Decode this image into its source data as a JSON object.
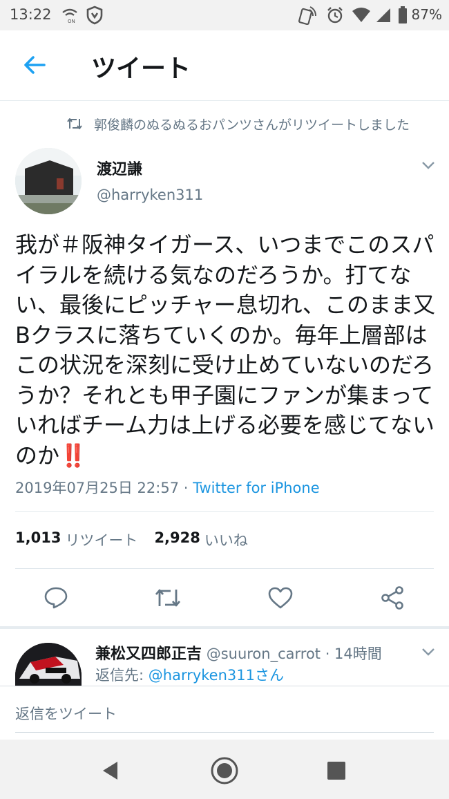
{
  "status_bar": {
    "time": "13:22",
    "battery": "87%",
    "icons": [
      "wifi-call-icon",
      "shield-icon",
      "nfc-icon",
      "alarm-icon",
      "wifi-icon",
      "signal-icon",
      "battery-icon"
    ]
  },
  "header": {
    "title": "ツイート",
    "back_icon": "back-arrow-icon"
  },
  "retweet_context": {
    "text": "郭俊麟のぬるぬるおパンツさんがリツイートしました"
  },
  "tweet": {
    "author_name": "渡辺謙",
    "author_handle": "@harryken311",
    "text": "我が＃阪神タイガース、いつまでこのスパイラルを続ける気なのだろうか。打てない、最後にピッチャー息切れ、このまま又Bクラスに落ちていくのか。毎年上層部はこの状況を深刻に受け止めていないのだろうか？それとも甲子園にファンが集まっていればチーム力は上げる必要を感じてないのか",
    "emoji": "‼️",
    "timestamp": "2019年07月25日 22:57",
    "separator": " · ",
    "via": "Twitter for iPhone",
    "retweet_count": "1,013",
    "retweet_label": "リツイート",
    "like_count": "2,928",
    "like_label": "いいね"
  },
  "actions": [
    "reply-icon",
    "retweet-icon",
    "like-icon",
    "share-icon"
  ],
  "reply": {
    "name": "兼松又四郎正吉",
    "handle": "@suuron_carrot",
    "time": " · 14時間",
    "reply_to_prefix": "返信先: ",
    "reply_to_link": "@harryken311さん"
  },
  "compose": {
    "placeholder": "返信をツイート"
  },
  "colors": {
    "accent": "#1da1f2",
    "link": "#1b95e0",
    "text": "#14171a",
    "secondary": "#657786",
    "emoji_red": "#d0021b"
  }
}
